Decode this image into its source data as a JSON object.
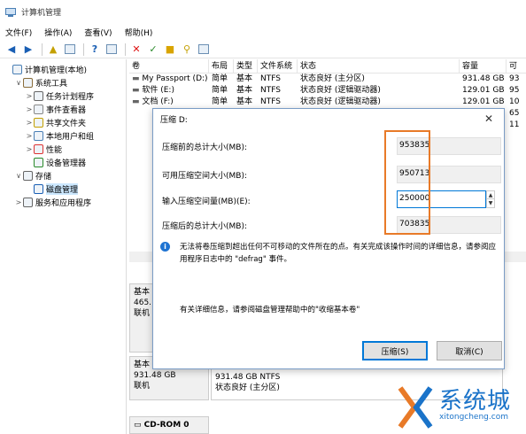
{
  "window": {
    "title": "计算机管理"
  },
  "menu": [
    "文件(F)",
    "操作(A)",
    "查看(V)",
    "帮助(H)"
  ],
  "toolbar": [
    "back-icon",
    "forward-icon",
    "up-icon",
    "properties-icon",
    "help-icon",
    "view-icon",
    "delete-icon",
    "check-icon",
    "folder-icon",
    "search-icon",
    "list-icon"
  ],
  "tree": [
    {
      "label": "计算机管理(本地)",
      "indent": 0,
      "arrow": ""
    },
    {
      "label": "系统工具",
      "indent": 1,
      "arrow": "∨"
    },
    {
      "label": "任务计划程序",
      "indent": 2,
      "arrow": ">"
    },
    {
      "label": "事件查看器",
      "indent": 2,
      "arrow": ">"
    },
    {
      "label": "共享文件夹",
      "indent": 2,
      "arrow": ">"
    },
    {
      "label": "本地用户和组",
      "indent": 2,
      "arrow": ">"
    },
    {
      "label": "性能",
      "indent": 2,
      "arrow": ">"
    },
    {
      "label": "设备管理器",
      "indent": 2,
      "arrow": ""
    },
    {
      "label": "存储",
      "indent": 1,
      "arrow": "∨"
    },
    {
      "label": "磁盘管理",
      "indent": 2,
      "arrow": ""
    },
    {
      "label": "服务和应用程序",
      "indent": 1,
      "arrow": ">"
    }
  ],
  "list": {
    "columns": [
      "卷",
      "布局",
      "类型",
      "文件系统",
      "状态",
      "容量",
      "可"
    ],
    "rows": [
      [
        "My Passport (D:)",
        "简单",
        "基本",
        "NTFS",
        "状态良好 (主分区)",
        "931.48 GB",
        "93"
      ],
      [
        "软件 (E:)",
        "简单",
        "基本",
        "NTFS",
        "状态良好 (逻辑驱动器)",
        "129.01 GB",
        "95"
      ],
      [
        "文档 (F:)",
        "简单",
        "基本",
        "NTFS",
        "状态良好 (逻辑驱动器)",
        "129.01 GB",
        "10"
      ],
      [
        "",
        "",
        "",
        "",
        "",
        "",
        "65"
      ],
      [
        "",
        "",
        "",
        "",
        "",
        "",
        "11"
      ]
    ]
  },
  "graphic": {
    "disk1": [
      "基本",
      "465.",
      "联机"
    ],
    "disk2": [
      "基本",
      "931.48 GB",
      "联机"
    ],
    "disk2_part": [
      "931.48 GB NTFS",
      "状态良好 (主分区)"
    ],
    "cdrom": "CD-ROM 0"
  },
  "dialog": {
    "title": "压缩 D:",
    "close": "✕",
    "fields": [
      {
        "label": "压缩前的总计大小(MB):",
        "value": "953835"
      },
      {
        "label": "可用压缩空间大小(MB):",
        "value": "950713"
      },
      {
        "label": "输入压缩空间量(MB)(E):",
        "value": "250000"
      },
      {
        "label": "压缩后的总计大小(MB):",
        "value": "703835"
      }
    ],
    "info": "无法将卷压缩到超出任何不可移动的文件所在的点。有关完成该操作时间的详细信息，请参阅应用程序日志中的 \"defrag\" 事件。",
    "more": "有关详细信息，请参阅磁盘管理帮助中的\"收缩基本卷\"",
    "shrink_btn": "压缩(S)",
    "cancel_btn": "取消(C)"
  },
  "watermark": {
    "text": "系统城",
    "url": "xitongcheng.com"
  },
  "colors": {
    "accent": "#0078d7",
    "highlight": "#e87a28",
    "watermark": "#1a73c9"
  }
}
